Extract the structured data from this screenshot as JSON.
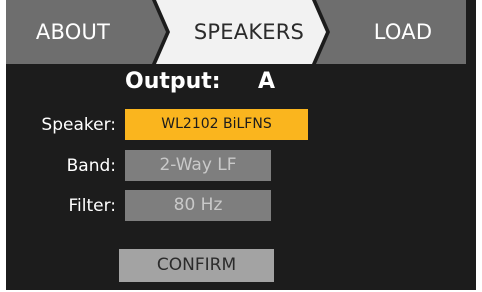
{
  "tabs": [
    {
      "label": "ABOUT",
      "active": false
    },
    {
      "label": "SPEAKERS",
      "active": true
    },
    {
      "label": "LOAD",
      "active": false
    }
  ],
  "output": {
    "label": "Output:",
    "value": "A"
  },
  "speaker": {
    "label": "Speaker:",
    "value": "WL2102 BiLFNS"
  },
  "band": {
    "label": "Band:",
    "value": "2-Way LF"
  },
  "filter": {
    "label": "Filter:",
    "value": "80 Hz"
  },
  "confirm": {
    "label": "CONFIRM"
  },
  "colors": {
    "background": "#1c1c1c",
    "tab_inactive": "#6e6e6e",
    "tab_active": "#f2f2f2",
    "speaker_field": "#fab51e",
    "disabled_field": "#7e7e7e",
    "confirm_button": "#a3a3a3"
  }
}
